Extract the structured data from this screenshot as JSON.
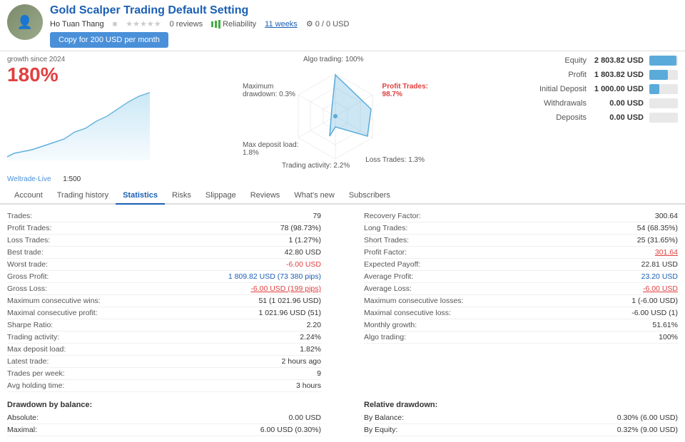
{
  "header": {
    "title": "Gold Scalper Trading Default Setting",
    "author": "Ho Tuan Thang",
    "reviews": "0 reviews",
    "reliability_label": "Reliability",
    "weeks": "11 weeks",
    "downloads": "0 / 0 USD",
    "copy_btn": "Copy for 200 USD per month"
  },
  "growth": {
    "since_label": "growth since 2024",
    "percent": "180%"
  },
  "radar": {
    "algo_trading": "Algo trading: 100%",
    "profit_trades": "Profit Trades:",
    "profit_trades_val": "98.7%",
    "loss_trades": "Loss Trades: 1.3%",
    "trading_activity": "Trading activity: 2.2%",
    "max_drawdown": "Maximum drawdown: 0.3%",
    "max_deposit_load": "Max deposit load: 1.8%"
  },
  "equity_stats": [
    {
      "label": "Equity",
      "value": "2 803.82 USD",
      "bar_pct": 95
    },
    {
      "label": "Profit",
      "value": "1 803.82 USD",
      "bar_pct": 65
    },
    {
      "label": "Initial Deposit",
      "value": "1 000.00 USD",
      "bar_pct": 36
    },
    {
      "label": "Withdrawals",
      "value": "0.00 USD",
      "bar_pct": 0
    },
    {
      "label": "Deposits",
      "value": "0.00 USD",
      "bar_pct": 0
    }
  ],
  "broker": {
    "name": "Weltrade-Live",
    "leverage": "1:500"
  },
  "tabs": [
    {
      "label": "Account",
      "active": false
    },
    {
      "label": "Trading history",
      "active": false
    },
    {
      "label": "Statistics",
      "active": true
    },
    {
      "label": "Risks",
      "active": false
    },
    {
      "label": "Slippage",
      "active": false
    },
    {
      "label": "Reviews",
      "active": false
    },
    {
      "label": "What's new",
      "active": false
    },
    {
      "label": "Subscribers",
      "active": false
    }
  ],
  "stats_left": [
    {
      "name": "Trades:",
      "val": "79",
      "style": ""
    },
    {
      "name": "Profit Trades:",
      "val": "78 (98.73%)",
      "style": ""
    },
    {
      "name": "Loss Trades:",
      "val": "1 (1.27%)",
      "style": ""
    },
    {
      "name": "Best trade:",
      "val": "42.80 USD",
      "style": ""
    },
    {
      "name": "Worst trade:",
      "val": "-6.00 USD",
      "style": "red"
    },
    {
      "name": "Gross Profit:",
      "val": "1 809.82 USD (73 380 pips)",
      "style": "blue"
    },
    {
      "name": "Gross Loss:",
      "val": "-6.00 USD (199 pips)",
      "style": "red-underline"
    },
    {
      "name": "Maximum consecutive wins:",
      "val": "51 (1 021.96 USD)",
      "style": ""
    },
    {
      "name": "Maximal consecutive profit:",
      "val": "1 021.96 USD (51)",
      "style": ""
    },
    {
      "name": "Sharpe Ratio:",
      "val": "2.20",
      "style": ""
    },
    {
      "name": "Trading activity:",
      "val": "2.24%",
      "style": ""
    },
    {
      "name": "Max deposit load:",
      "val": "1.82%",
      "style": ""
    },
    {
      "name": "Latest trade:",
      "val": "2 hours ago",
      "style": ""
    },
    {
      "name": "Trades per week:",
      "val": "9",
      "style": ""
    },
    {
      "name": "Avg holding time:",
      "val": "3 hours",
      "style": ""
    }
  ],
  "stats_right": [
    {
      "name": "Recovery Factor:",
      "val": "300.64",
      "style": ""
    },
    {
      "name": "Long Trades:",
      "val": "54 (68.35%)",
      "style": ""
    },
    {
      "name": "Short Trades:",
      "val": "25 (31.65%)",
      "style": ""
    },
    {
      "name": "Profit Factor:",
      "val": "301.64",
      "style": "red-underline"
    },
    {
      "name": "Expected Payoff:",
      "val": "22.81 USD",
      "style": ""
    },
    {
      "name": "Average Profit:",
      "val": "23.20 USD",
      "style": "blue"
    },
    {
      "name": "Average Loss:",
      "val": "-6.00 USD",
      "style": "red-underline"
    },
    {
      "name": "Maximum consecutive losses:",
      "val": "1 (-6.00 USD)",
      "style": ""
    },
    {
      "name": "Maximal consecutive loss:",
      "val": "-6.00 USD (1)",
      "style": ""
    },
    {
      "name": "Monthly growth:",
      "val": "51.61%",
      "style": ""
    },
    {
      "name": "Algo trading:",
      "val": "100%",
      "style": ""
    }
  ],
  "drawdown_left": {
    "title": "Drawdown by balance:",
    "rows": [
      {
        "name": "Absolute:",
        "val": "0.00 USD"
      },
      {
        "name": "Maximal:",
        "val": "6.00 USD (0.30%)"
      }
    ]
  },
  "drawdown_right": {
    "title": "Relative drawdown:",
    "rows": [
      {
        "name": "By Balance:",
        "val": "0.30% (6.00 USD)"
      },
      {
        "name": "By Equity:",
        "val": "0.32% (9.00 USD)"
      }
    ]
  }
}
